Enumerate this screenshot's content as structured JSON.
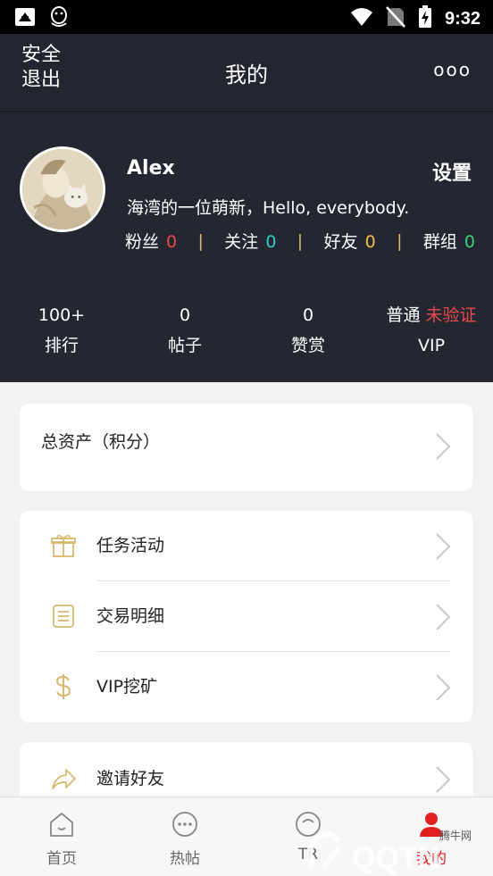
{
  "status_bar": {
    "time": "9:32",
    "icons": [
      "notification-app-icon",
      "qq-penguin-icon",
      "wifi-icon",
      "no-sim-icon",
      "battery-charging-icon"
    ]
  },
  "header": {
    "left_label": "安全退出",
    "title": "我的",
    "more_label": "ooo"
  },
  "profile": {
    "username": "Alex",
    "settings_label": "设置",
    "bio": "海湾的一位萌新，Hello, everybody.",
    "social": [
      {
        "label": "粉丝",
        "value": "0",
        "color": "#e64a4a"
      },
      {
        "label": "关注",
        "value": "0",
        "color": "#2ad0c8"
      },
      {
        "label": "好友",
        "value": "0",
        "color": "#f0c040"
      },
      {
        "label": "群组",
        "value": "0",
        "color": "#34d27a"
      }
    ],
    "separator": "|"
  },
  "stats": [
    {
      "value": "100+",
      "label": "排行"
    },
    {
      "value": "0",
      "label": "帖子"
    },
    {
      "value": "0",
      "label": "赞赏"
    }
  ],
  "vip": {
    "level": "普通",
    "status": "未验证",
    "label": "VIP"
  },
  "assets": {
    "title": "总资产（积分）"
  },
  "menu": [
    {
      "label": "任务活动",
      "icon": "gift-icon"
    },
    {
      "label": "交易明细",
      "icon": "document-list-icon"
    },
    {
      "label": "VIP挖矿",
      "icon": "dollar-icon"
    }
  ],
  "invite": {
    "label": "邀请好友",
    "icon": "share-arrow-icon"
  },
  "bottom_nav": [
    {
      "label": "首页",
      "icon": "home-icon"
    },
    {
      "label": "热帖",
      "icon": "chat-bubble-icon"
    },
    {
      "label": "TR",
      "icon": "tr-circle-icon"
    },
    {
      "label": "我的",
      "icon": "person-icon"
    }
  ],
  "colors": {
    "header_bg": "#232630",
    "accent_gold": "#d8b870",
    "alert_red": "#e64a4a",
    "active_tab": "#e02020"
  },
  "watermark": {
    "text": "QQTN",
    "subtext": "腾牛网"
  }
}
